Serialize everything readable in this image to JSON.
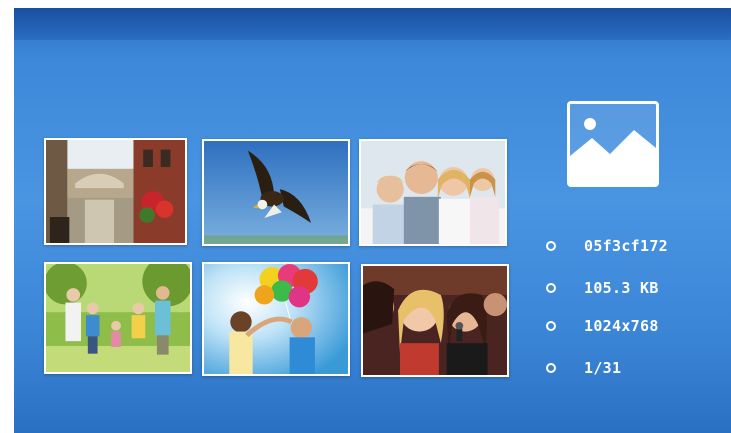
{
  "viewer": {
    "info": {
      "filename": "05f3cf172",
      "filesize": "105.3 KB",
      "resolution": "1024x768",
      "position": "1/31"
    },
    "thumbnails": [
      {
        "name": "venice-canal"
      },
      {
        "name": "eagle-in-sky"
      },
      {
        "name": "family-portrait"
      },
      {
        "name": "family-park"
      },
      {
        "name": "balloons-kids"
      },
      {
        "name": "friends-singing"
      }
    ]
  }
}
